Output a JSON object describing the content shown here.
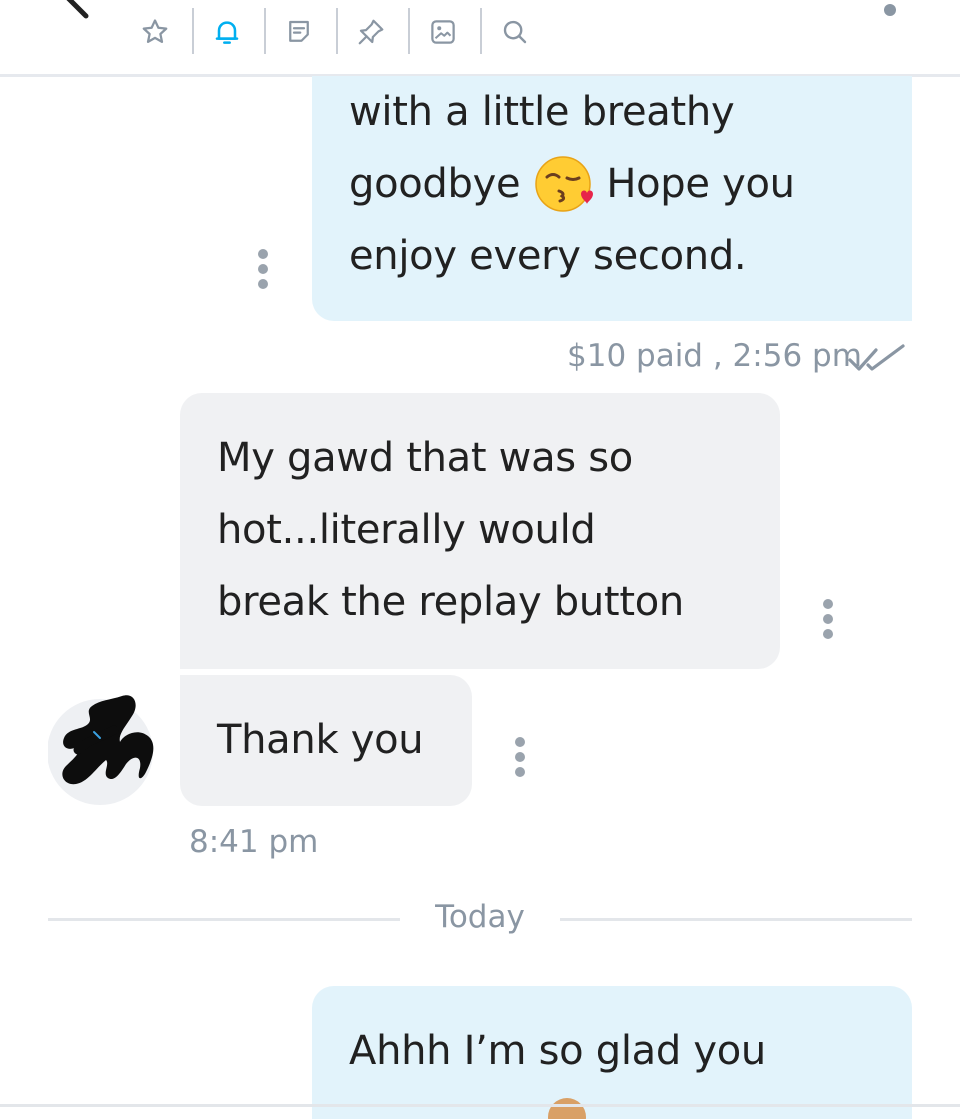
{
  "toolbar": {
    "icons": [
      {
        "name": "star-icon"
      },
      {
        "name": "bell-icon",
        "color": "#00aff0"
      },
      {
        "name": "note-icon"
      },
      {
        "name": "pin-icon"
      },
      {
        "name": "gallery-icon"
      },
      {
        "name": "search-icon"
      }
    ],
    "accent_color": "#00aff0"
  },
  "messages": [
    {
      "direction": "outgoing",
      "lines": [
        "with a little breathy",
        "goodbye",
        "Hope you",
        "enjoy every second."
      ],
      "emoji": "kiss-wink-heart-emoji",
      "meta": "$10 paid , 2:56 pm",
      "status_icon": "double-check-icon"
    },
    {
      "direction": "incoming",
      "lines": [
        "My gawd that was so",
        "hot...literally would",
        "break the replay button"
      ]
    },
    {
      "direction": "incoming",
      "lines": [
        "Thank you"
      ],
      "meta": "8:41 pm"
    },
    {
      "direction": "outgoing",
      "lines": [
        "Ahhh I’m so glad you"
      ]
    }
  ],
  "day_divider": "Today",
  "colors": {
    "outgoing_bubble": "#e2f3fb",
    "incoming_bubble": "#f0f1f3",
    "meta_text": "#8a96a3"
  }
}
